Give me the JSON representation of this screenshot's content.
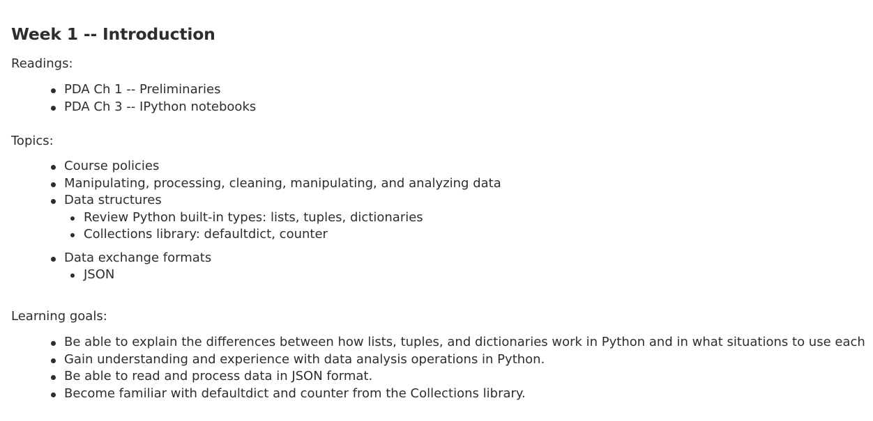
{
  "title": "Week 1 -- Introduction",
  "readings": {
    "label": "Readings:",
    "items": [
      "PDA Ch 1 -- Preliminaries",
      "PDA Ch 3 -- IPython notebooks"
    ]
  },
  "topics": {
    "label": "Topics:",
    "items": [
      {
        "text": "Course policies"
      },
      {
        "text": "Manipulating, processing, cleaning, manipulating, and analyzing data"
      },
      {
        "text": "Data structures",
        "subitems": [
          "Review Python built-in types: lists, tuples, dictionaries",
          "Collections library: defaultdict, counter"
        ]
      },
      {
        "text": "Data exchange formats",
        "subitems": [
          "JSON"
        ]
      }
    ]
  },
  "learning_goals": {
    "label": "Learning goals:",
    "items": [
      "Be able to explain the differences between how lists, tuples, and dictionaries work in Python and in what situations to use each",
      "Gain understanding and experience with data analysis operations in Python.",
      "Be able to read and process data in JSON format.",
      "Become familiar with defaultdict and counter from the Collections library."
    ]
  }
}
